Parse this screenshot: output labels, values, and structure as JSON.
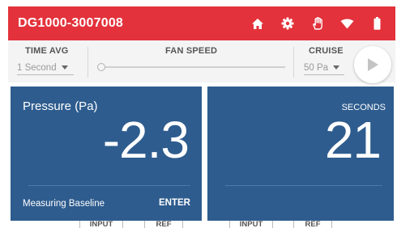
{
  "header": {
    "title": "DG1000-3007008",
    "color": "#e3323b",
    "icons": [
      "home-icon",
      "gear-icon",
      "hand-icon",
      "wifi-icon",
      "battery-icon"
    ]
  },
  "controls": {
    "time_avg": {
      "label": "TIME AVG",
      "value": "1 Second"
    },
    "fan_speed": {
      "label": "FAN SPEED",
      "level": 0
    },
    "cruise": {
      "label": "CRUISE",
      "value": "50 Pa"
    },
    "play_icon": "play-icon"
  },
  "panels": {
    "pressure": {
      "title": "Pressure (Pa)",
      "value": "-2.3",
      "status": "Measuring Baseline",
      "action": "ENTER",
      "color": "#2e5c8e"
    },
    "time": {
      "caption": "SECONDS",
      "value": "21"
    }
  },
  "bottom_tabs": [
    "INPUT",
    "REF",
    "INPUT",
    "REF"
  ]
}
